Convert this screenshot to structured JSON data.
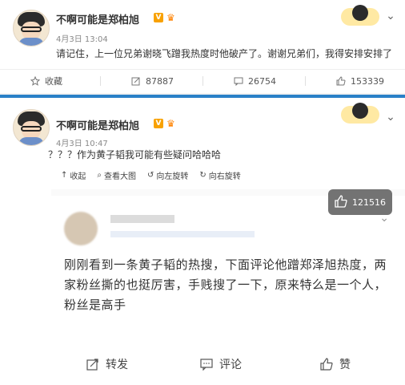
{
  "post1": {
    "author": "不啊可能是郑柏旭",
    "verified_badge": "V",
    "time": "4月3日 13:04",
    "text": "请记住，上一位兄弟谢晓飞蹭我热度时他破产了。谢谢兄弟们，我得安排安排了",
    "actions": {
      "favorite": "收藏",
      "repost_count": "87887",
      "comment_count": "26754",
      "like_count": "153339"
    }
  },
  "post2": {
    "author": "不啊可能是郑柏旭",
    "verified_badge": "V",
    "time": "4月3日 10:47",
    "text": "？？？作为黄子韬我可能有些疑问哈哈哈",
    "mini_actions": {
      "collapse": "收起",
      "view_large": "查看大图",
      "rotate_left": "向左旋转",
      "rotate_right": "向右旋转"
    },
    "like_count": "121516",
    "embedded": {
      "text": "刚刚看到一条黄子韬的热搜，下面评论他蹭郑泽旭热度，两家粉丝撕的也挺厉害，手贱搜了一下，原来特么是一个人，粉丝是高手",
      "repost": "转发",
      "comment": "评论",
      "like": "赞"
    }
  },
  "colors": {
    "accent_blue": "#2a80c7",
    "vip_orange": "#ff8200"
  }
}
